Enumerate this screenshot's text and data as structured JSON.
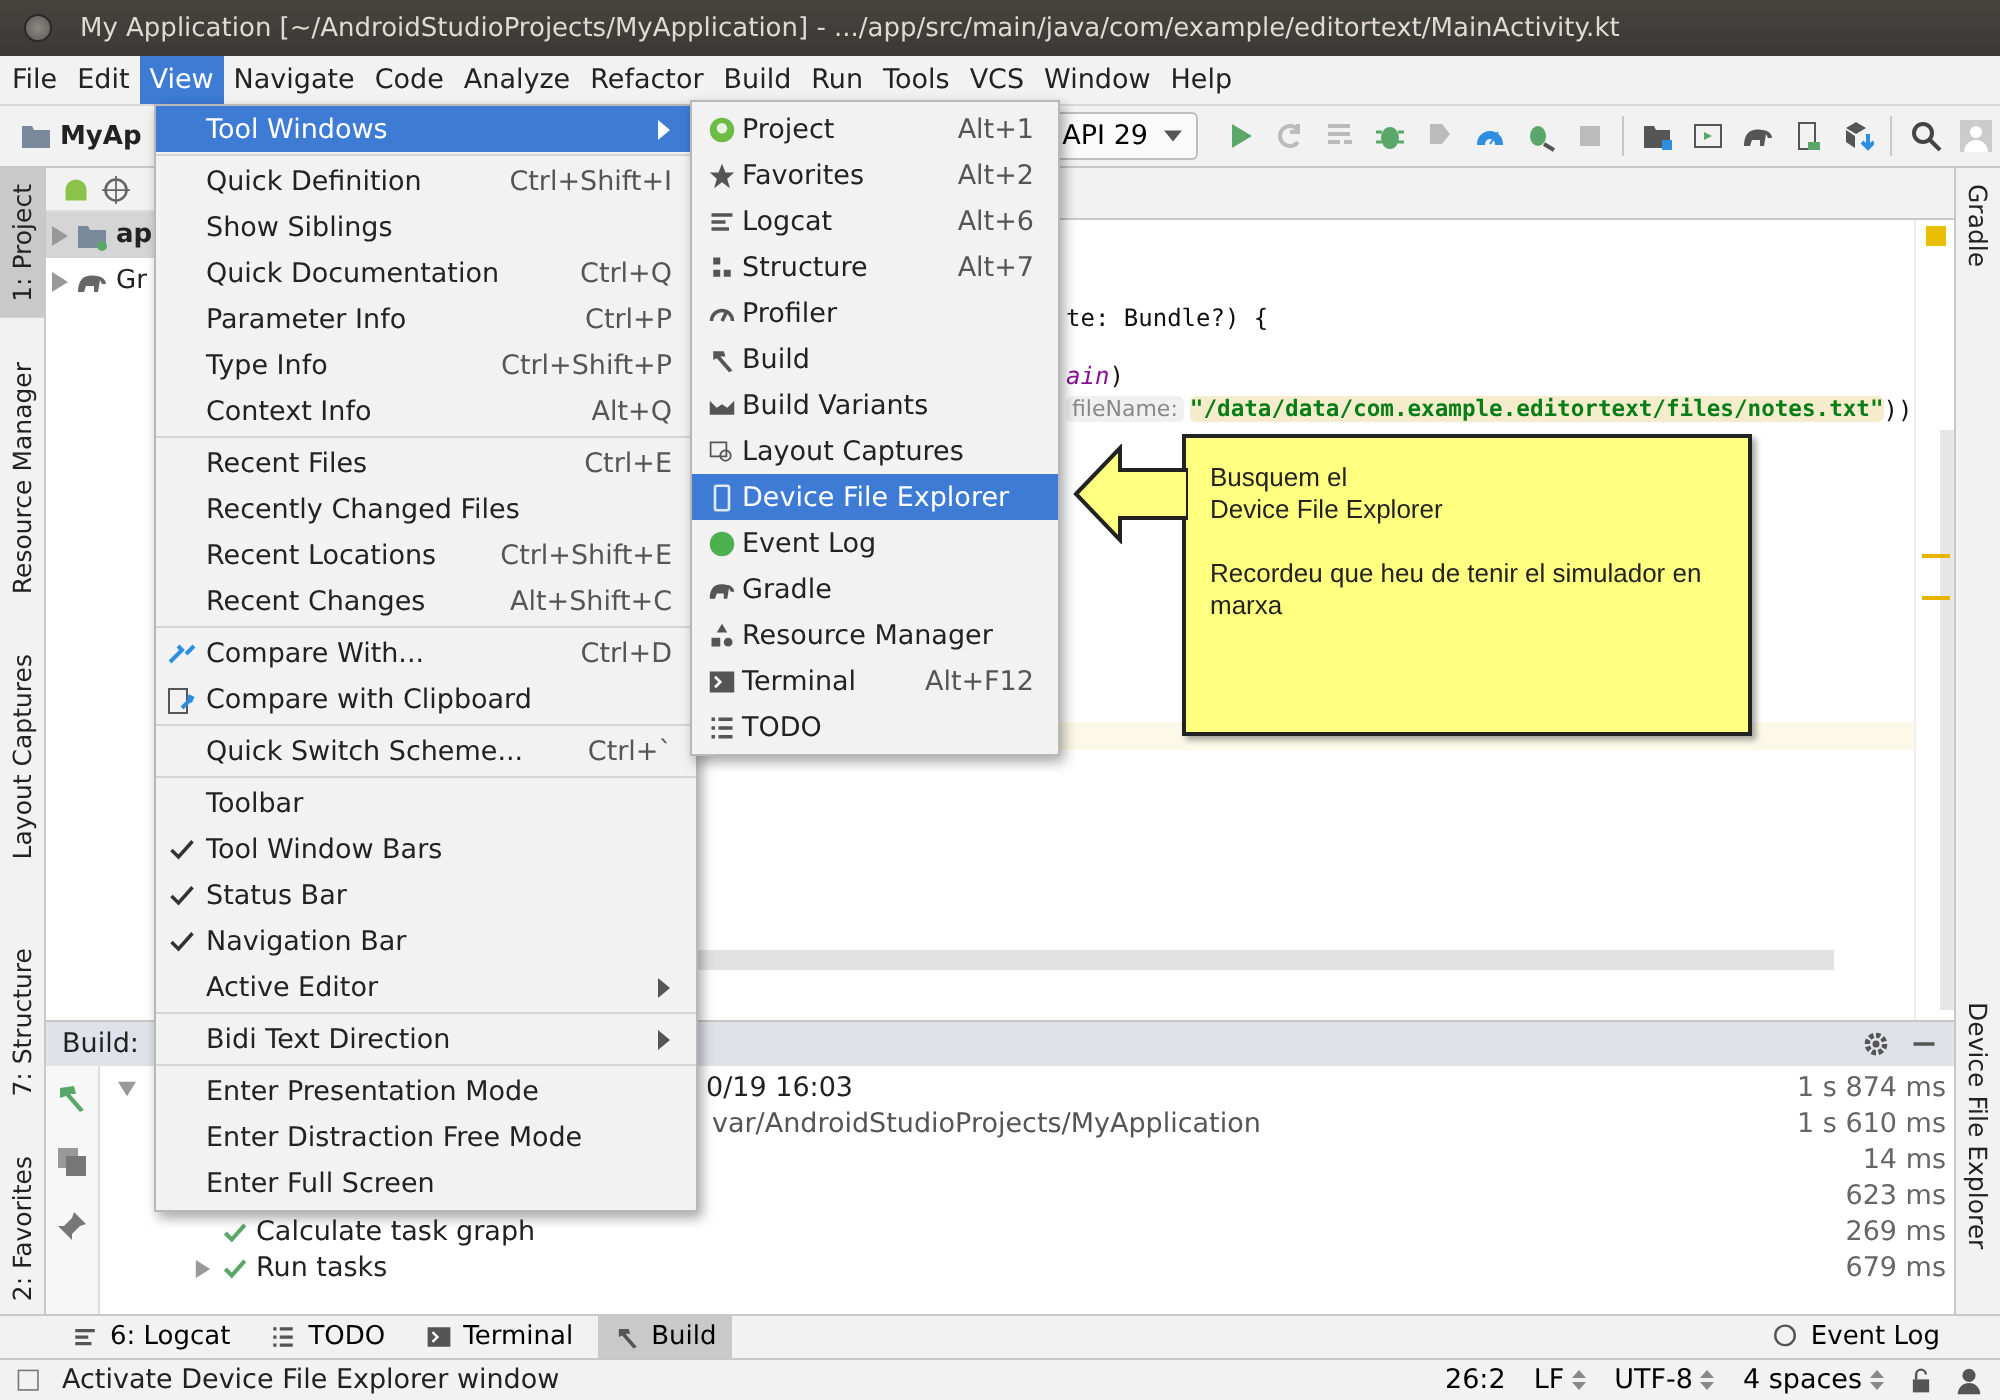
{
  "window": {
    "title": "My Application [~/AndroidStudioProjects/MyApplication] - .../app/src/main/java/com/example/editortext/MainActivity.kt"
  },
  "menu_bar": [
    {
      "label": "File",
      "selected": false
    },
    {
      "label": "Edit",
      "selected": false
    },
    {
      "label": "View",
      "selected": true
    },
    {
      "label": "Navigate",
      "selected": false
    },
    {
      "label": "Code",
      "selected": false
    },
    {
      "label": "Analyze",
      "selected": false
    },
    {
      "label": "Refactor",
      "selected": false
    },
    {
      "label": "Build",
      "selected": false
    },
    {
      "label": "Run",
      "selected": false
    },
    {
      "label": "Tools",
      "selected": false
    },
    {
      "label": "VCS",
      "selected": false
    },
    {
      "label": "Window",
      "selected": false
    },
    {
      "label": "Help",
      "selected": false
    }
  ],
  "toolbar": {
    "breadcrumb": "MyAp",
    "device": "API 29"
  },
  "view_menu": {
    "groups": [
      [
        {
          "label": "Tool Windows",
          "selected": true,
          "checked": false,
          "submenu": true
        }
      ],
      [
        {
          "label": "Quick Definition",
          "shortcut": "Ctrl+Shift+I",
          "selected": false,
          "checked": false,
          "submenu": false
        },
        {
          "label": "Show Siblings",
          "selected": false,
          "checked": false,
          "submenu": false
        },
        {
          "label": "Quick Documentation",
          "shortcut": "Ctrl+Q",
          "selected": false,
          "checked": false,
          "submenu": false
        },
        {
          "label": "Parameter Info",
          "shortcut": "Ctrl+P",
          "selected": false,
          "checked": false,
          "submenu": false
        },
        {
          "label": "Type Info",
          "shortcut": "Ctrl+Shift+P",
          "selected": false,
          "checked": false,
          "submenu": false
        },
        {
          "label": "Context Info",
          "shortcut": "Alt+Q",
          "selected": false,
          "checked": false,
          "submenu": false
        }
      ],
      [
        {
          "label": "Recent Files",
          "shortcut": "Ctrl+E",
          "selected": false,
          "checked": false,
          "submenu": false
        },
        {
          "label": "Recently Changed Files",
          "selected": false,
          "checked": false,
          "submenu": false
        },
        {
          "label": "Recent Locations",
          "shortcut": "Ctrl+Shift+E",
          "selected": false,
          "checked": false,
          "submenu": false
        },
        {
          "label": "Recent Changes",
          "shortcut": "Alt+Shift+C",
          "selected": false,
          "checked": false,
          "submenu": false
        }
      ],
      [
        {
          "label": "Compare With...",
          "shortcut": "Ctrl+D",
          "selected": false,
          "checked": false,
          "submenu": false
        },
        {
          "label": "Compare with Clipboard",
          "selected": false,
          "checked": false,
          "submenu": false
        }
      ],
      [
        {
          "label": "Quick Switch Scheme...",
          "shortcut": "Ctrl+`",
          "selected": false,
          "checked": false,
          "submenu": false
        }
      ],
      [
        {
          "label": "Toolbar",
          "selected": false,
          "checked": false,
          "submenu": false
        },
        {
          "label": "Tool Window Bars",
          "selected": false,
          "checked": true,
          "submenu": false
        },
        {
          "label": "Status Bar",
          "selected": false,
          "checked": true,
          "submenu": false
        },
        {
          "label": "Navigation Bar",
          "selected": false,
          "checked": true,
          "submenu": false
        },
        {
          "label": "Active Editor",
          "selected": false,
          "checked": false,
          "submenu": true
        }
      ],
      [
        {
          "label": "Bidi Text Direction",
          "selected": false,
          "checked": false,
          "submenu": true
        }
      ],
      [
        {
          "label": "Enter Presentation Mode",
          "selected": false,
          "checked": false,
          "submenu": false
        },
        {
          "label": "Enter Distraction Free Mode",
          "selected": false,
          "checked": false,
          "submenu": false
        },
        {
          "label": "Enter Full Screen",
          "selected": false,
          "checked": false,
          "submenu": false
        }
      ]
    ]
  },
  "tool_windows_menu": {
    "items": [
      {
        "label": "Project",
        "shortcut": "Alt+1",
        "selected": false
      },
      {
        "label": "Favorites",
        "shortcut": "Alt+2",
        "selected": false
      },
      {
        "label": "Logcat",
        "shortcut": "Alt+6",
        "selected": false
      },
      {
        "label": "Structure",
        "shortcut": "Alt+7",
        "selected": false
      },
      {
        "label": "Profiler",
        "selected": false
      },
      {
        "label": "Build",
        "selected": false
      },
      {
        "label": "Build Variants",
        "selected": false
      },
      {
        "label": "Layout Captures",
        "selected": false
      },
      {
        "label": "Device File Explorer",
        "selected": true
      },
      {
        "label": "Event Log",
        "selected": false
      },
      {
        "label": "Gradle",
        "selected": false
      },
      {
        "label": "Resource Manager",
        "selected": false
      },
      {
        "label": "Terminal",
        "shortcut": "Alt+F12",
        "selected": false
      },
      {
        "label": "TODO",
        "selected": false
      }
    ]
  },
  "left_tool_tabs": [
    {
      "label": "1: Project",
      "selected": true
    },
    {
      "label": "Resource Manager",
      "selected": false
    },
    {
      "label": "Layout Captures",
      "selected": false
    }
  ],
  "left_tool_tabs_bottom": [
    {
      "label": "7: Structure",
      "selected": false
    },
    {
      "label": "2: Favorites",
      "selected": false
    }
  ],
  "right_tool_tabs": [
    {
      "label": "Gradle"
    },
    {
      "label": "Device File Explorer"
    }
  ],
  "project_panel": {
    "rows": [
      {
        "text": "ap",
        "kind": "module"
      },
      {
        "text": "Gr",
        "kind": "gradle"
      }
    ]
  },
  "editor": {
    "lines": [
      {
        "segments": [
          {
            "text": "te: Bundle?) {",
            "kind": "plain"
          }
        ]
      },
      {
        "segments": [
          {
            "text": "ain",
            "kind": "italic"
          },
          {
            "text": ")",
            "kind": "plain"
          }
        ]
      },
      {
        "segments": [
          {
            "text": "fileName:",
            "kind": "hint"
          },
          {
            "text": "\"/data/data/com.example.editortext/files/notes.txt\"",
            "kind": "string"
          },
          {
            "text": "))",
            "kind": "plain"
          }
        ]
      }
    ]
  },
  "callout": {
    "paragraphs": [
      "Busquem el\nDevice File Explorer",
      "Recordeu que heu de tenir el simulador en marxa"
    ]
  },
  "build_panel": {
    "title": "Build:",
    "rows": [
      {
        "text": "0/19 16:03",
        "time": "1 s 874 ms",
        "expanded": true,
        "children": [
          {
            "text": "var/AndroidStudioProjects/MyApplication",
            "time": "1 s 610 ms",
            "children": [
              {
                "time": "14 ms"
              },
              {
                "time": "623 ms"
              },
              {
                "text": "Calculate task graph",
                "time": "269 ms",
                "succeeded": true
              },
              {
                "text": "Run tasks",
                "time": "679 ms",
                "succeeded": true,
                "expanded": false
              }
            ]
          }
        ]
      }
    ]
  },
  "bottom_tabs": [
    {
      "label": "6: Logcat",
      "selected": false
    },
    {
      "label": "TODO",
      "selected": false
    },
    {
      "label": "Terminal",
      "selected": false
    },
    {
      "label": "Build",
      "selected": true
    }
  ],
  "event_log": "Event Log",
  "status_bar": {
    "message": "Activate Device File Explorer window",
    "items": [
      "26:2",
      "LF",
      "UTF-8",
      "4 spaces"
    ]
  }
}
